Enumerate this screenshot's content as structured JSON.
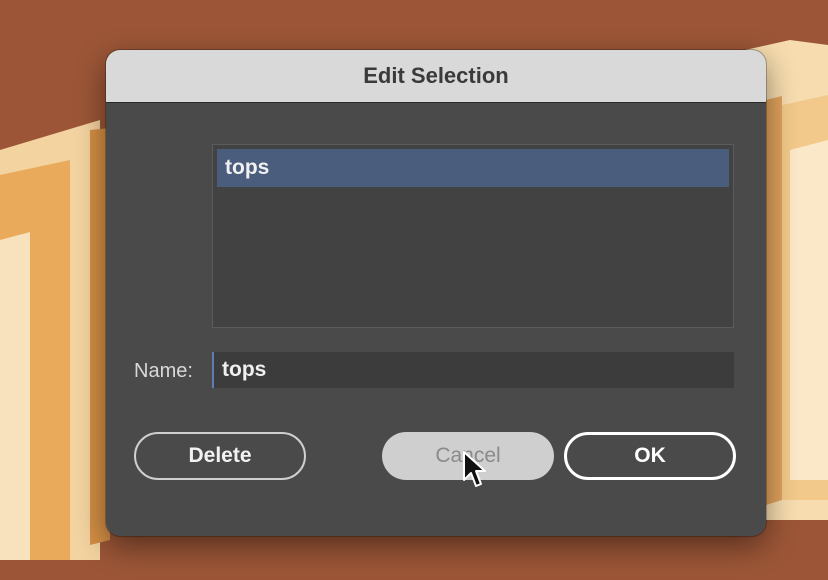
{
  "dialog": {
    "title": "Edit Selection",
    "list": {
      "items": [
        {
          "label": "tops",
          "selected": true
        }
      ]
    },
    "name_label": "Name:",
    "name_value": "tops",
    "buttons": {
      "delete": "Delete",
      "cancel": "Cancel",
      "ok": "OK"
    }
  },
  "colors": {
    "background": "#9c5637",
    "artwork_orange": "#e7a85a",
    "artwork_cream": "#f6dcae",
    "dialog_body": "#4a4a4a",
    "title_bar": "#d9d9d9",
    "selection": "#4a5d7c"
  },
  "cursor": {
    "icon": "arrow-pointer-icon"
  }
}
